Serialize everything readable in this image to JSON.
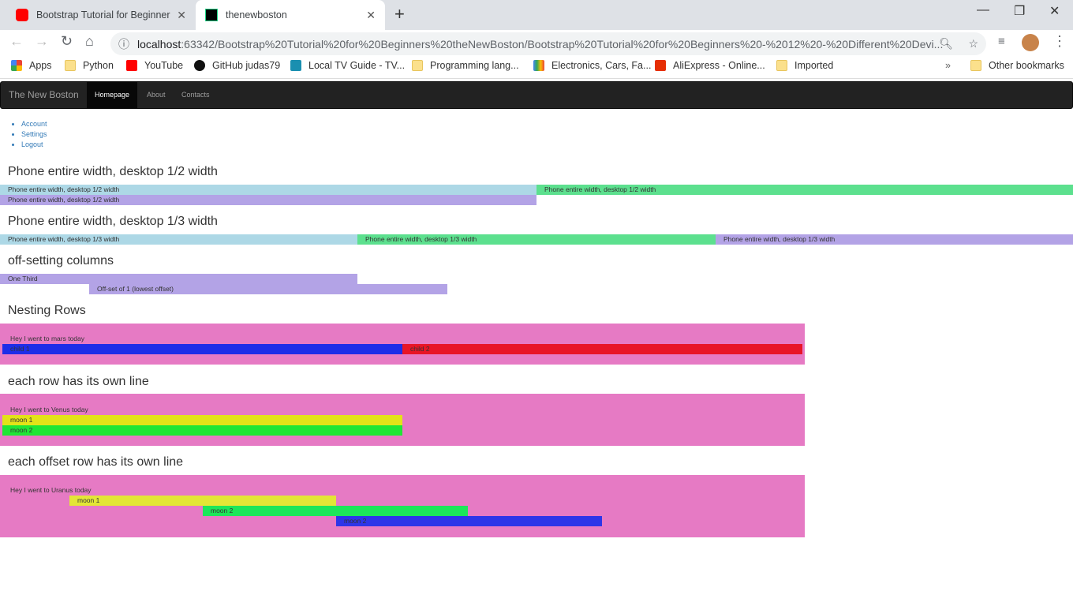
{
  "browser": {
    "tabs": [
      {
        "title": "Bootstrap Tutorial for Beginners - ",
        "icon": "youtube-icon"
      },
      {
        "title": "thenewboston",
        "icon": "pycharm-icon"
      }
    ],
    "url_host": "localhost",
    "url_path": ":63342/Bootstrap%20Tutorial%20for%20Beginners%20theNewBoston/Bootstrap%20Tutorial%20for%20Beginners%20-%2012%20-%20Different%20Devi...",
    "bookmarks": [
      "Apps",
      "Python",
      "YouTube",
      "GitHub judas79",
      "Local TV Guide - TV...",
      "Programming lang...",
      "Electronics, Cars, Fa...",
      "AliExpress - Online...",
      "Imported"
    ],
    "other_bookmarks": "Other bookmarks"
  },
  "navbar": {
    "brand": "The New Boston",
    "items": [
      "Homepage",
      "About",
      "Contacts"
    ]
  },
  "menu": [
    "Account",
    "Settings",
    "Logout"
  ],
  "sections": {
    "half": {
      "title": "Phone entire width, desktop 1/2 width",
      "cols": [
        "Phone entire width, desktop 1/2 width",
        "Phone entire width, desktop 1/2 width",
        "Phone entire width, desktop 1/2 width"
      ]
    },
    "third": {
      "title": "Phone entire width, desktop 1/3 width",
      "cols": [
        "Phone entire width, desktop 1/3 width",
        "Phone entire width, desktop 1/3 width",
        "Phone entire width, desktop 1/3 width"
      ]
    },
    "offset": {
      "title": "off-setting columns",
      "cols": [
        "One Third",
        "Off-set of 1 (lowest offset)"
      ]
    },
    "nesting": {
      "title": "Nesting Rows",
      "text": "Hey I went to mars today",
      "cols": [
        "child 1",
        "child 2"
      ]
    },
    "own_line": {
      "title": "each row has its own line",
      "text": "Hey I went to Venus today",
      "cols": [
        "moon 1",
        "moon 2"
      ]
    },
    "offset_line": {
      "title": "each offset row has its own line",
      "text": "Hey I went to Uranus today",
      "cols": [
        "moon 1",
        "moon 2",
        "moon 2"
      ]
    }
  },
  "colors": {
    "lightblue": "#add8e6",
    "green": "#5ce08e",
    "purple": "#b3a3e6",
    "pink": "#e67ac4",
    "blue": "#1e2de8",
    "red": "#e81527",
    "yellow": "#e3e318"
  }
}
